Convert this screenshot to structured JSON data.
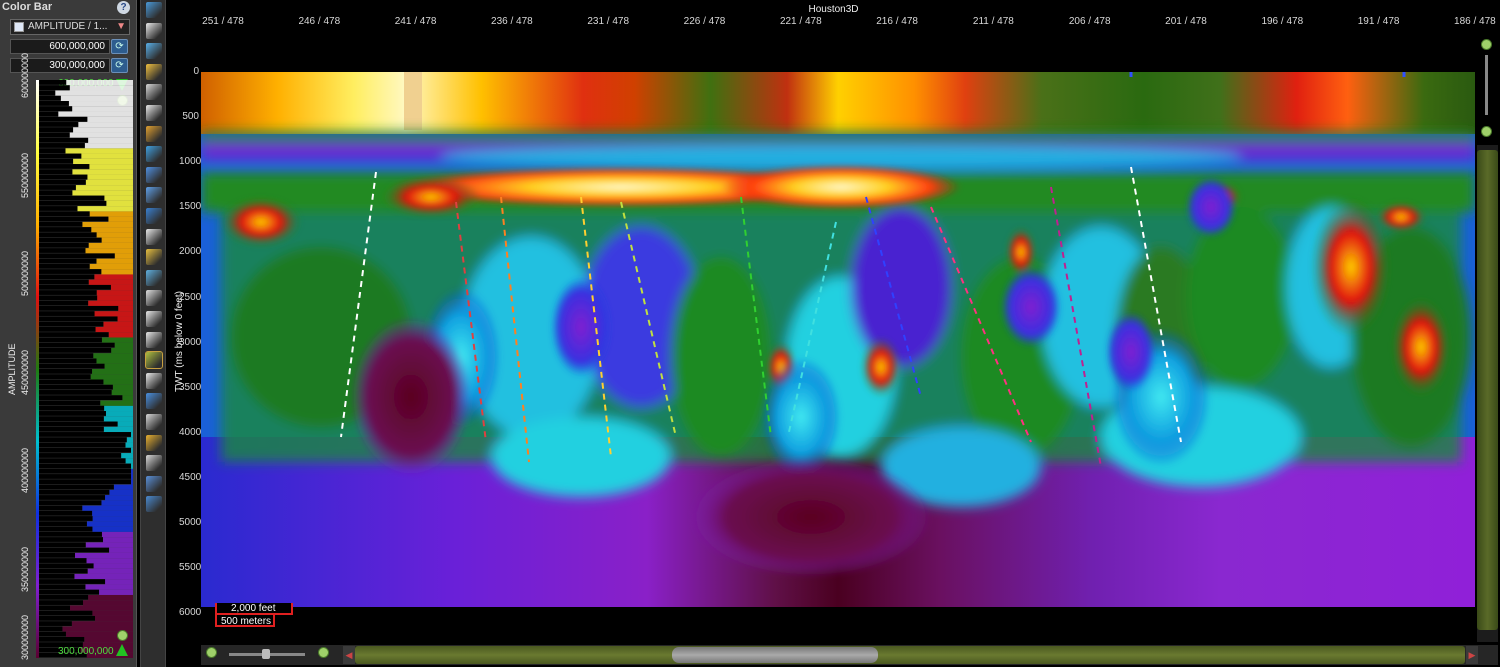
{
  "color_bar": {
    "title": "Color Bar",
    "help_icon": "question-icon",
    "attribute_label": "AMPLITUDE / 1...",
    "max_value": "600,000,000",
    "min_value": "300,000,000",
    "top_value": "600,000,000",
    "bottom_value": "300,000,000",
    "axis_label": "AMPLITUDE",
    "tick_labels": [
      "600000000",
      "550000000",
      "500000000",
      "450000000",
      "400000000",
      "350000000",
      "300000000"
    ],
    "colors": [
      "#ffffff",
      "#ffff40",
      "#ffb000",
      "#e01010",
      "#207a10",
      "#00c0d0",
      "#1030e0",
      "#8020d0",
      "#5a0030"
    ]
  },
  "toolbar": {
    "icons": [
      "pointer-icon",
      "zoom-icon",
      "rotate-icon",
      "grid-icon",
      "fit-icon",
      "dots-icon",
      "layers-icon",
      "pick-icon",
      "draw-icon",
      "fault-icon",
      "select-icon",
      "annotate-icon",
      "polygon-icon",
      "stack-icon",
      "color-icon",
      "wand-icon",
      "paint-icon",
      "horizon-icon",
      "brush-icon",
      "shape-icon",
      "rectangle-icon",
      "copy-icon",
      "pencil-icon",
      "dots2-icon",
      "expand-icon"
    ]
  },
  "viewer": {
    "title": "Houston3D",
    "x_ticks": [
      "251 / 478",
      "246 / 478",
      "241 / 478",
      "236 / 478",
      "231 / 478",
      "226 / 478",
      "221 / 478",
      "216 / 478",
      "211 / 478",
      "206 / 478",
      "201 / 478",
      "196 / 478",
      "191 / 478",
      "186 / 478"
    ],
    "y_ticks": [
      "0",
      "500",
      "1000",
      "1500",
      "2000",
      "2500",
      "3000",
      "3500",
      "4000",
      "4500",
      "5000",
      "5500",
      "6000"
    ],
    "y_label": "TWT (ms below 0 feet)",
    "scale_feet": "2,000 feet",
    "scale_meters": "500 meters"
  }
}
